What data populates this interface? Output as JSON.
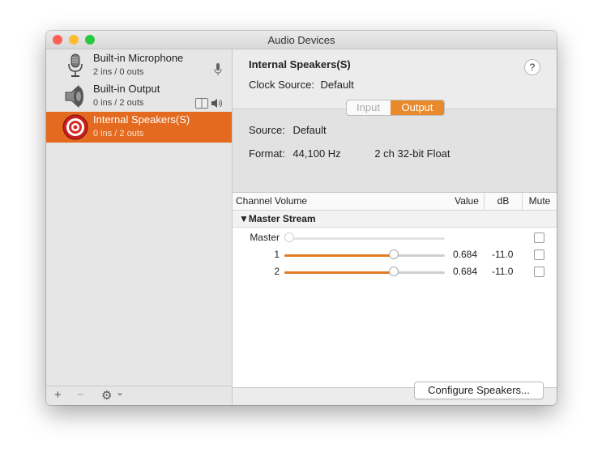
{
  "window": {
    "title": "Audio Devices",
    "traffic_lights": {
      "close": "#fe5f57",
      "minimize": "#febc2e",
      "zoom": "#28c840"
    }
  },
  "sidebar": {
    "devices": [
      {
        "name": "Built-in Microphone",
        "sub": "2 ins / 0 outs",
        "icon": "microphone-icon",
        "selected": false
      },
      {
        "name": "Built-in Output",
        "sub": "0 ins / 2 outs",
        "icon": "speaker-icon",
        "selected": false
      },
      {
        "name": "Internal Speakers(S)",
        "sub": "0 ins / 2 outs",
        "icon": "target-speaker-icon",
        "selected": true
      }
    ],
    "footer": {
      "add": "+",
      "remove": "−",
      "gear": "⚙",
      "chevron": "⌄"
    }
  },
  "main": {
    "device_name": "Internal Speakers(S)",
    "clock_label": "Clock Source:",
    "clock_value": "Default",
    "help": "?",
    "tabs": {
      "input": "Input",
      "output": "Output",
      "selected": "Output"
    },
    "source_label": "Source:",
    "source_value": "Default",
    "format_label": "Format:",
    "format_rate": "44,100 Hz",
    "format_detail": "2 ch 32-bit Float",
    "table": {
      "headers": {
        "channel": "Channel Volume",
        "value": "Value",
        "db": "dB",
        "mute": "Mute"
      },
      "stream": "▼Master Stream",
      "rows": [
        {
          "label": "Master",
          "level": 0,
          "value": "",
          "db": "",
          "enabled": false
        },
        {
          "label": "1",
          "level": 0.684,
          "value": "0.684",
          "db": "-11.0",
          "enabled": true
        },
        {
          "label": "2",
          "level": 0.684,
          "value": "0.684",
          "db": "-11.0",
          "enabled": true
        }
      ]
    },
    "configure_button": "Configure Speakers..."
  },
  "colors": {
    "accent": "#e46a1f",
    "slider": "#e07b23"
  }
}
